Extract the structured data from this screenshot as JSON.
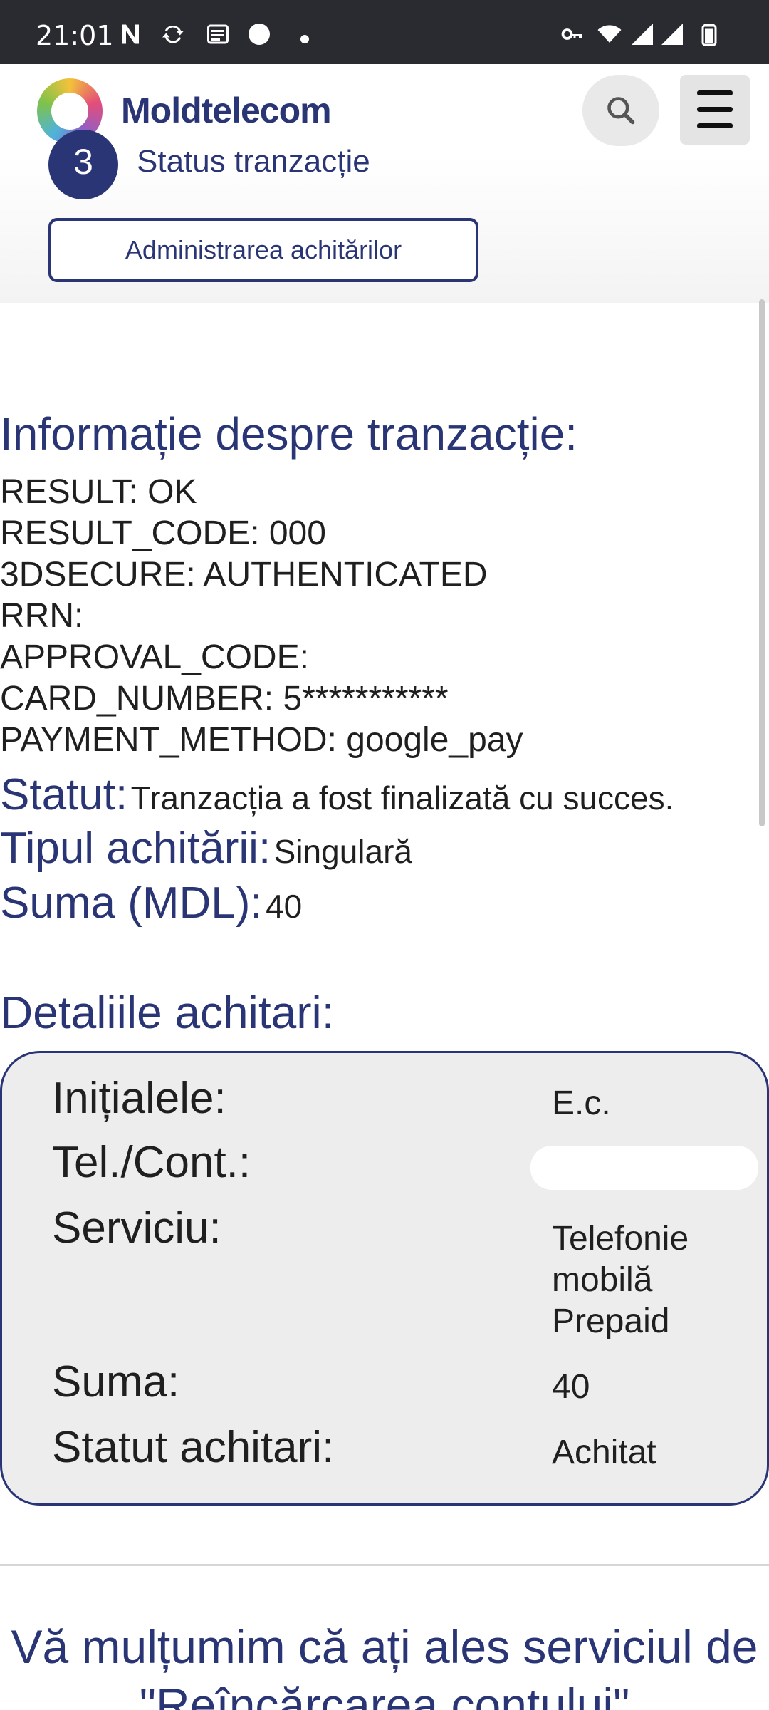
{
  "status_bar": {
    "time": "21:01",
    "icons": [
      "n-icon",
      "sync-icon",
      "news-icon",
      "circle-icon",
      "vpn-key-icon",
      "wifi-icon",
      "signal-icon",
      "signal-icon",
      "battery-icon"
    ]
  },
  "header": {
    "brand": "Moldtelecom"
  },
  "step": {
    "number": "3",
    "title": "Status tranzacție",
    "admin_button": "Administrarea achitărilor"
  },
  "transaction": {
    "heading": "Informație despre tranzacție:",
    "lines": [
      "RESULT: OK",
      "RESULT_CODE: 000",
      "3DSECURE: AUTHENTICATED",
      "RRN:",
      "APPROVAL_CODE:",
      "CARD_NUMBER: 5***********",
      "PAYMENT_METHOD: google_pay"
    ],
    "status_label": "Statut:",
    "status_value": "Tranzacția a fost finalizată cu succes.",
    "type_label": "Tipul achitării:",
    "type_value": "Singulară",
    "sum_label": "Suma (MDL):",
    "sum_value": "40"
  },
  "details": {
    "heading": "Detaliile achitari:",
    "rows": [
      {
        "label": "Inițialele:",
        "value": "E.c."
      },
      {
        "label": "Tel./Cont.:",
        "value": ""
      },
      {
        "label": "Serviciu:",
        "value": "Telefonie mobilă Prepaid"
      },
      {
        "label": "Suma:",
        "value": "40"
      },
      {
        "label": "Statut achitari:",
        "value": "Achitat"
      }
    ]
  },
  "footer": {
    "thanks": "Vă mulțumim că ați ales serviciul de \"Reîncărcarea contului\""
  },
  "colors": {
    "brand": "#2a3575",
    "card_bg": "#ededed",
    "status_bar": "#2a2b30"
  }
}
